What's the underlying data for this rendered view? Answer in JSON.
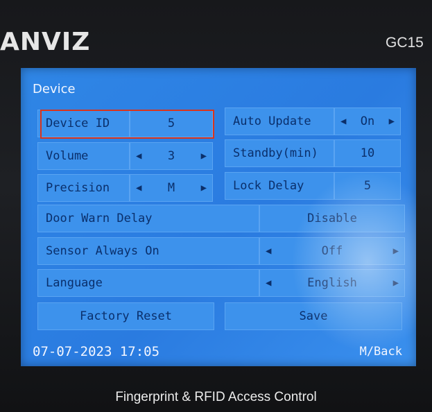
{
  "device": {
    "brand": "ANVIZ",
    "model": "GC15",
    "caption": "Fingerprint & RFID Access Control"
  },
  "screen": {
    "title": "Device",
    "rows": [
      {
        "label": "Device ID",
        "value": "5"
      },
      {
        "label": "Auto Update",
        "value": "On"
      },
      {
        "label": "Volume",
        "value": "3"
      },
      {
        "label": "Standby(min)",
        "value": "10"
      },
      {
        "label": "Precision",
        "value": "M"
      },
      {
        "label": "Lock Delay",
        "value": "5"
      },
      {
        "label": "Door Warn Delay",
        "value": "Disable"
      },
      {
        "label": "Sensor Always On",
        "value": "Off"
      },
      {
        "label": "Language",
        "value": "English"
      }
    ],
    "buttons": {
      "factory_reset": "Factory Reset",
      "save": "Save"
    },
    "footer": {
      "datetime": "07-07-2023 17:05",
      "back": "M/Back"
    },
    "icons": {
      "left": "arrow-left-icon",
      "right": "arrow-right-icon"
    },
    "selected_item": "Device ID",
    "colors": {
      "screen": "#2f86e6",
      "selection": "#d9341c"
    }
  }
}
